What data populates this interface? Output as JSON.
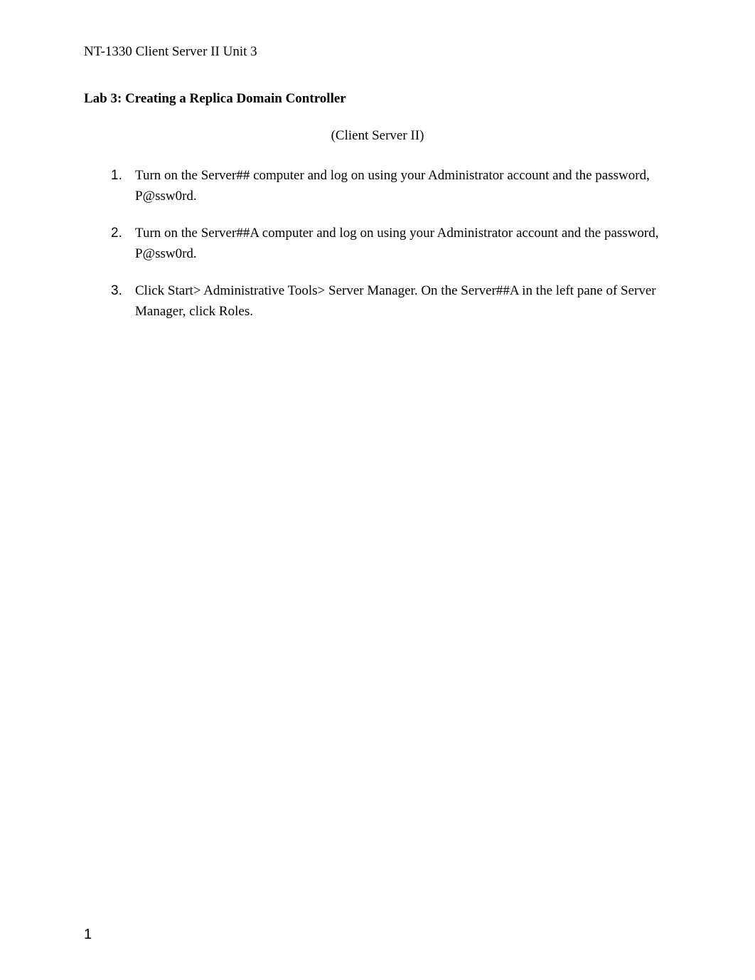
{
  "header": "NT-1330 Client Server II Unit 3",
  "title": "Lab 3:  Creating a Replica Domain Controller",
  "subtitle": "(Client Server II)",
  "list": {
    "items": [
      {
        "marker": "1.",
        "text": "Turn on the Server## computer and log on using your Administrator account and the password, P@ssw0rd."
      },
      {
        "marker": "2.",
        "text": "Turn on the Server##A computer and log on using your Administrator account and the password, P@ssw0rd."
      },
      {
        "marker": "3.",
        "text": "Click Start> Administrative Tools> Server Manager. On the Server##A in the left pane of Server Manager, click Roles."
      }
    ]
  },
  "pageNumber": "1"
}
